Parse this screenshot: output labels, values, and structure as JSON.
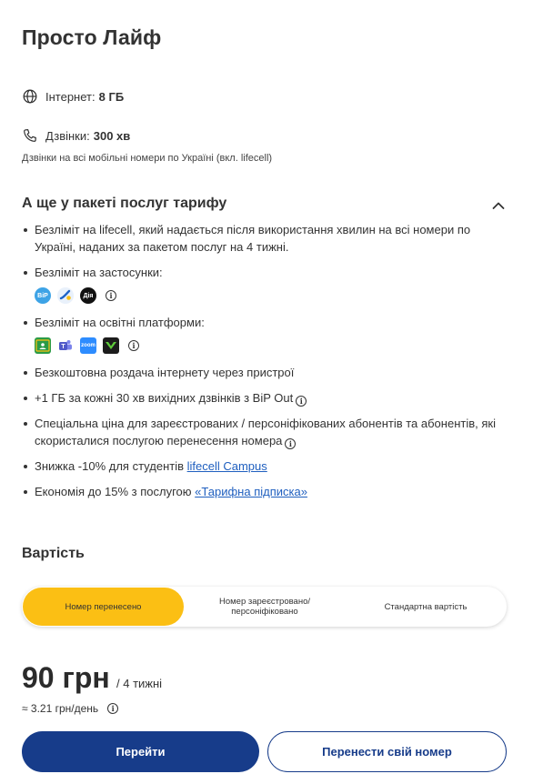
{
  "tariff": {
    "title": "Просто Лайф"
  },
  "features": {
    "internet_label": "Інтернет:",
    "internet_value": "8 ГБ",
    "calls_label": "Дзвінки:",
    "calls_value": "300 хв",
    "calls_note": "Дзвінки на всі мобільні номери по Україні (вкл. lifecell)"
  },
  "extras": {
    "title": "А ще у пакеті послуг тарифу",
    "items": {
      "unlimited_lifecell": "Безліміт на lifecell, який надається після використання хвилин на всі номери по Україні, наданих за пакетом послуг на 4 тижні.",
      "unlimited_apps": "Безліміт на застосунки:",
      "unlimited_edu": "Безліміт на освітні платформи:",
      "hotspot": "Безкоштовна роздача інтернету через пристрої",
      "bip_bonus": "+1 ГБ за кожні 30 хв вихідних дзвінків з BiP Out",
      "special_price": "Спеціальна ціна для зареєстрованих / персоніфікованих абонентів та абонентів, які скористалися послугою перенесення номера",
      "students_prefix": "Знижка -10% для студентів",
      "students_link": "lifecell Campus",
      "savings_prefix": "Економія до 15% з послугою",
      "savings_link": "«Тарифна підписка»"
    },
    "app_icons": [
      "bip-icon",
      "lifecell-app-icon",
      "diia-icon"
    ],
    "edu_icons": [
      "google-classroom-icon",
      "ms-teams-icon",
      "zoom-icon",
      "educational-app-icon"
    ],
    "app_icon_text": {
      "bip": "BiP",
      "diia": "Дія",
      "zoom": "zoom"
    }
  },
  "cost": {
    "title": "Вартість",
    "options": [
      "Номер перенесено",
      "Номер зареєстровано/ персоніфіковано",
      "Стандартна вартість"
    ],
    "selected": "Номер перенесено"
  },
  "price": {
    "amount": "90 грн",
    "period": "/ 4 тижні",
    "per_day": "≈ 3.21 грн/день"
  },
  "actions": {
    "go": "Перейти",
    "transfer": "Перенести свій номер"
  },
  "colors": {
    "accent": "#fbbf14",
    "primary": "#173c8a",
    "link": "#1f5fbf"
  }
}
